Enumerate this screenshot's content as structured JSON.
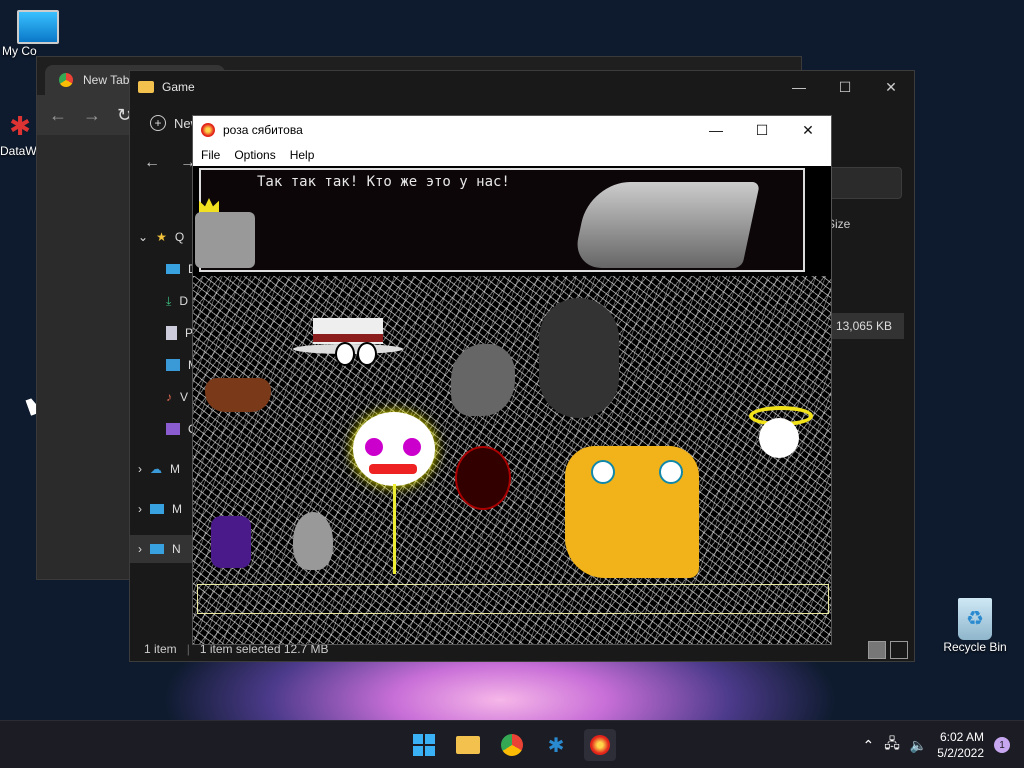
{
  "desktop": {
    "icons": [
      {
        "label": "My Co"
      },
      {
        "label": "DataW"
      },
      {
        "label": "Recycle Bin"
      }
    ]
  },
  "chrome": {
    "tab_title": "New Tab"
  },
  "explorer": {
    "title": "Game",
    "new_button": "New",
    "nav_items": [
      {
        "label": "Q"
      },
      {
        "label": "D"
      },
      {
        "label": "D"
      },
      {
        "label": "P"
      },
      {
        "label": "M"
      },
      {
        "label": "V"
      },
      {
        "label": "O"
      },
      {
        "label": "M"
      },
      {
        "label": "N"
      }
    ],
    "column_size": "Size",
    "file_size": "13,065 KB",
    "status_count": "1 item",
    "status_selected": "1 item selected  12.7 MB"
  },
  "game": {
    "title": "роза сябитова",
    "menu": [
      "File",
      "Options",
      "Help"
    ],
    "dialog_text": "Так так так! Кто же это у нас!"
  },
  "taskbar": {
    "time": "6:02 AM",
    "date": "5/2/2022",
    "notifications": "1"
  },
  "colors": {
    "accent": "#0078d4",
    "taskbar": "#1c1c24",
    "explorer_bg": "#191919"
  }
}
